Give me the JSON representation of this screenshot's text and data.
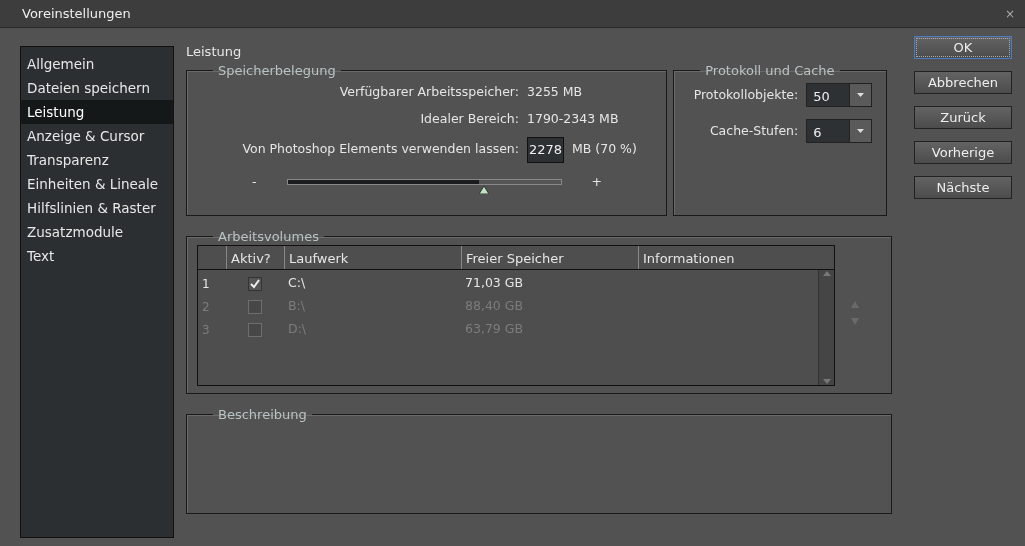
{
  "window": {
    "title": "Voreinstellungen",
    "close": "×"
  },
  "sidebar": {
    "items": [
      {
        "label": "Allgemein",
        "selected": false
      },
      {
        "label": "Dateien speichern",
        "selected": false
      },
      {
        "label": "Leistung",
        "selected": true
      },
      {
        "label": "Anzeige & Cursor",
        "selected": false
      },
      {
        "label": "Transparenz",
        "selected": false
      },
      {
        "label": "Einheiten & Lineale",
        "selected": false
      },
      {
        "label": "Hilfslinien & Raster",
        "selected": false
      },
      {
        "label": "Zusatzmodule",
        "selected": false
      },
      {
        "label": "Text",
        "selected": false
      }
    ]
  },
  "page_title": "Leistung",
  "memory": {
    "title": "Speicherbelegung",
    "rows": [
      {
        "label": "Verfügbarer Arbeitsspeicher:",
        "value": "3255 MB"
      },
      {
        "label": "Idealer Bereich:",
        "value": "1790-2343 MB"
      }
    ],
    "use_label": "Von Photoshop Elements verwenden lassen:",
    "use_value": "2278",
    "use_unit": "MB (70 %)",
    "slider": {
      "minus": "-",
      "plus": "+",
      "level": 0.7
    }
  },
  "history_cache": {
    "title": "Protokoll und Cache",
    "fields": [
      {
        "label": "Protokollobjekte:",
        "value": "50"
      },
      {
        "label": "Cache-Stufen:",
        "value": "6"
      }
    ]
  },
  "buttons": [
    {
      "label": "OK",
      "default": true
    },
    {
      "label": "Abbrechen",
      "default": false
    },
    {
      "label": "Zurück",
      "default": false
    },
    {
      "label": "Vorherige",
      "default": false
    },
    {
      "label": "Nächste",
      "default": false
    }
  ],
  "volumes": {
    "title": "Arbeitsvolumes",
    "columns": [
      "Aktiv?",
      "Laufwerk",
      "Freier Speicher",
      "Informationen"
    ],
    "rows": [
      {
        "index": "1",
        "checked": true,
        "disabled": false,
        "drive": "C:\\",
        "free": "71,03 GB"
      },
      {
        "index": "2",
        "checked": false,
        "disabled": true,
        "drive": "B:\\",
        "free": "88,40 GB"
      },
      {
        "index": "3",
        "checked": false,
        "disabled": true,
        "drive": "D:\\",
        "free": "63,79 GB"
      }
    ]
  },
  "description": {
    "title": "Beschreibung"
  }
}
